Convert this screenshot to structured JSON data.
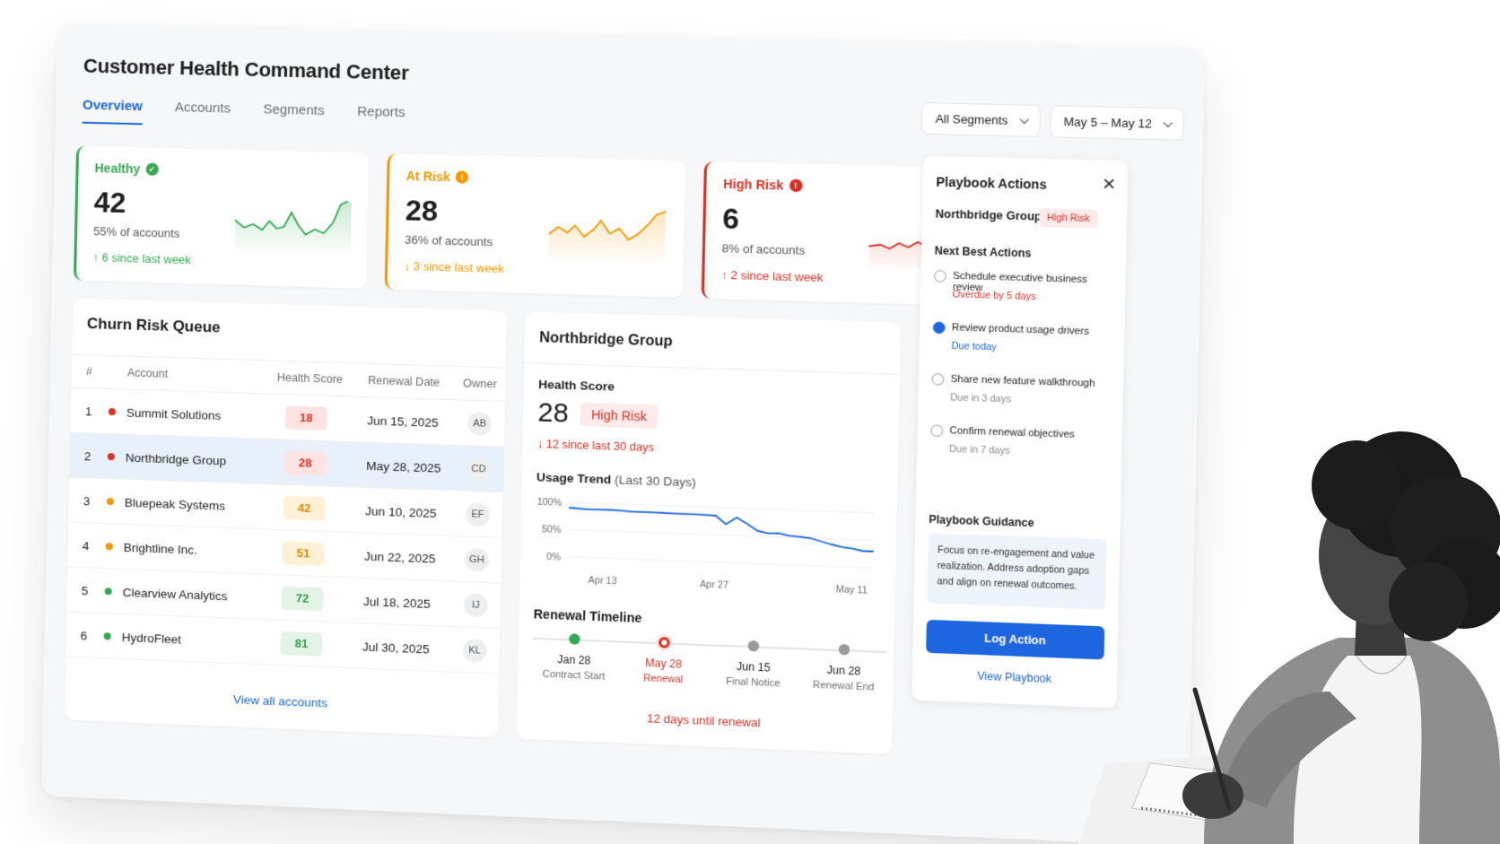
{
  "app": {
    "title": "Customer Health Command Center"
  },
  "tabs": [
    "Overview",
    "Accounts",
    "Segments",
    "Reports"
  ],
  "filters": {
    "segment": "All Segments",
    "date_range": "May 5 – May 12"
  },
  "kpis": [
    {
      "label": "Healthy",
      "value": "42",
      "share": "55% of accounts",
      "change": "↑ 6 since last week",
      "color": "#34a853",
      "icon": "check"
    },
    {
      "label": "At Risk",
      "value": "28",
      "share": "36% of accounts",
      "change": "↓ 3 since last week",
      "color": "#f29900",
      "icon": "!"
    },
    {
      "label": "High Risk",
      "value": "6",
      "share": "8% of accounts",
      "change": "↑ 2 since last week",
      "color": "#d93025",
      "icon": "!"
    }
  ],
  "queue": {
    "title": "Churn Risk Queue",
    "columns": [
      "#",
      "Account",
      "Health Score",
      "Renewal Date",
      "Owner"
    ],
    "rows": [
      {
        "n": "1",
        "account": "Summit Solutions",
        "score": "18",
        "renewal": "Jun 15, 2025",
        "owner": "AB",
        "status": "red"
      },
      {
        "n": "2",
        "account": "Northbridge Group",
        "score": "28",
        "renewal": "May 28, 2025",
        "owner": "CD",
        "status": "red"
      },
      {
        "n": "3",
        "account": "Bluepeak Systems",
        "score": "42",
        "renewal": "Jun 10, 2025",
        "owner": "EF",
        "status": "orange"
      },
      {
        "n": "4",
        "account": "Brightline Inc.",
        "score": "51",
        "renewal": "Jun 22, 2025",
        "owner": "GH",
        "status": "orange"
      },
      {
        "n": "5",
        "account": "Clearview Analytics",
        "score": "72",
        "renewal": "Jul 18, 2025",
        "owner": "IJ",
        "status": "green"
      },
      {
        "n": "6",
        "account": "HydroFleet",
        "score": "81",
        "renewal": "Jul 30, 2025",
        "owner": "KL",
        "status": "green"
      }
    ],
    "view_all": "View all accounts"
  },
  "detail": {
    "account": "Northbridge Group",
    "health_label": "Health Score",
    "health_value": "28",
    "health_badge": "High Risk",
    "health_change": "↓ 12 since last 30 days",
    "usage_label": "Usage Trend",
    "usage_sub": "(Last 30 Days)",
    "timeline_label": "Renewal Timeline",
    "timeline": [
      {
        "date": "Jan 28",
        "caption": "Contract Start",
        "state": "done"
      },
      {
        "date": "May 28",
        "caption": "Renewal",
        "state": "current"
      },
      {
        "date": "Jun 15",
        "caption": "Final Notice",
        "state": "future"
      },
      {
        "date": "Jun 28",
        "caption": "Renewal End",
        "state": "future"
      }
    ],
    "until": "12 days until renewal"
  },
  "chart_data": {
    "type": "line",
    "title": "Usage Trend",
    "xlabel": "",
    "ylabel": "",
    "ylim": [
      0,
      100
    ],
    "yticks": [
      "100%",
      "50%",
      "0%"
    ],
    "xticks": [
      "Apr 13",
      "Apr 27",
      "May 11"
    ],
    "grid": true,
    "x": [
      1,
      3,
      5,
      7,
      9,
      11,
      13,
      15,
      16,
      17,
      18,
      19,
      20,
      21,
      22,
      23,
      24,
      25,
      26,
      27,
      28,
      29,
      30
    ],
    "series": [
      {
        "values": [
          90,
          88,
          89,
          87,
          87,
          86,
          86,
          85,
          70,
          83,
          72,
          60,
          56,
          57,
          53,
          52,
          50,
          45,
          40,
          36,
          34,
          30,
          30
        ]
      }
    ]
  },
  "playbook": {
    "title": "Playbook Actions",
    "account": "Northbridge Group",
    "risk": "High Risk",
    "nba_label": "Next Best Actions",
    "actions": [
      {
        "title": "Schedule executive business review",
        "status": "Overdue by 5 days",
        "tone": "overdue",
        "selected": false
      },
      {
        "title": "Review product usage drivers",
        "status": "Due today",
        "tone": "today",
        "selected": true
      },
      {
        "title": "Share new feature walkthrough",
        "status": "Due in 3 days",
        "tone": "later",
        "selected": false
      },
      {
        "title": "Confirm renewal objectives",
        "status": "Due in 7 days",
        "tone": "later",
        "selected": false
      }
    ],
    "guidance_label": "Playbook Guidance",
    "guidance": "Focus on re-engagement and value realization. Address adoption gaps and align on renewal outcomes.",
    "log_button": "Log Action",
    "view_link": "View Playbook"
  }
}
